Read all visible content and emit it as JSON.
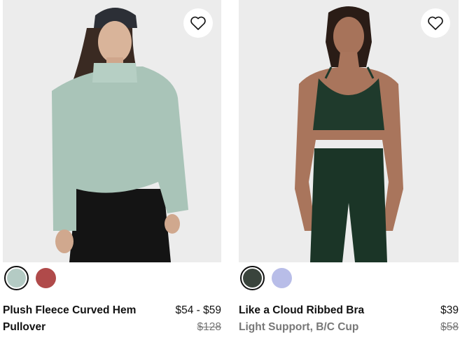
{
  "products": [
    {
      "name": "Plush Fleece Curved Hem Pullover",
      "subtitle": "",
      "price": "$54 - $59",
      "original_price": "$128",
      "swatches": [
        {
          "color": "#b4cbc4",
          "selected": true
        },
        {
          "color": "#b04a4a",
          "selected": false
        }
      ],
      "wishlist_icon": "heart-outline-icon"
    },
    {
      "name": "Like a Cloud Ribbed Bra",
      "subtitle": "Light Support, B/C Cup",
      "price": "$39",
      "original_price": "$58",
      "swatches": [
        {
          "color": "#3a443c",
          "selected": true
        },
        {
          "color": "#b8bde8",
          "selected": false
        }
      ],
      "wishlist_icon": "heart-outline-icon"
    }
  ]
}
